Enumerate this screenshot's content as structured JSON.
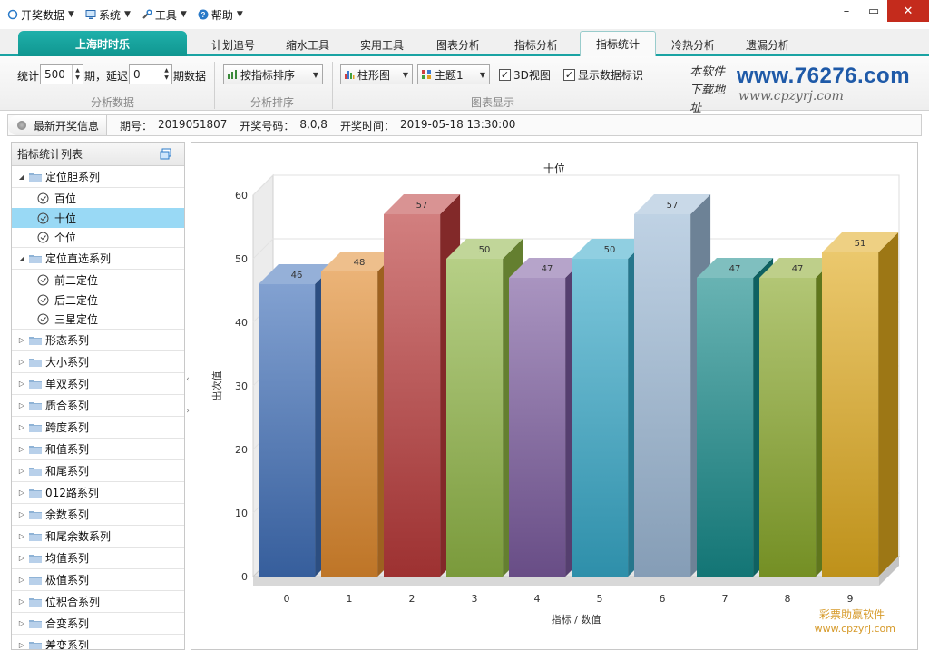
{
  "menu": {
    "items": [
      {
        "label": "开奖数据",
        "icon": "circle-icon"
      },
      {
        "label": "系统",
        "icon": "monitor-icon"
      },
      {
        "label": "工具",
        "icon": "tools-icon"
      },
      {
        "label": "帮助",
        "icon": "help-icon"
      }
    ],
    "window_controls": {
      "minimize": "–",
      "restore": "▭",
      "close": "✕"
    }
  },
  "tabs": {
    "brand": "上海时时乐",
    "items": [
      "计划追号",
      "缩水工具",
      "实用工具",
      "图表分析",
      "指标分析",
      "指标统计",
      "冷热分析",
      "遗漏分析"
    ],
    "active": "指标统计"
  },
  "toolbar": {
    "stat_label": "统计",
    "stat_value": "500",
    "periods_delay_label": "期，延迟",
    "delay_value": "0",
    "period_data_label": "期数据",
    "group1_label": "分析数据",
    "sort_value": "按指标排序",
    "group2_label": "分析排序",
    "chart_type_value": "柱形图",
    "theme_value": "主题1",
    "view3d_label": "3D视图",
    "show_labels_label": "显示数据标识",
    "group3_label": "图表显示",
    "view3d_checked": "✓",
    "show_labels_checked": "✓"
  },
  "watermark": {
    "cn_line1": "本软件",
    "cn_line2": "下载地址",
    "url1": "www.76276.com",
    "url2": "www.cpzyrj.com",
    "bottom_name": "彩票助赢软件",
    "bottom_url": "www.cpzyrj.com"
  },
  "infobar": {
    "pill": "最新开奖信息",
    "issue_label": "期号：",
    "issue_value": "2019051807",
    "numbers_label": "开奖号码：",
    "numbers_value": "8,0,8",
    "time_label": "开奖时间：",
    "time_value": "2019-05-18 13:30:00"
  },
  "sidebar": {
    "title": "指标统计列表",
    "groups": [
      {
        "label": "定位胆系列",
        "expanded": true,
        "children": [
          "百位",
          "十位",
          "个位"
        ]
      },
      {
        "label": "定位直选系列",
        "expanded": true,
        "children": [
          "前二定位",
          "后二定位",
          "三星定位"
        ]
      },
      {
        "label": "形态系列"
      },
      {
        "label": "大小系列"
      },
      {
        "label": "单双系列"
      },
      {
        "label": "质合系列"
      },
      {
        "label": "跨度系列"
      },
      {
        "label": "和值系列"
      },
      {
        "label": "和尾系列"
      },
      {
        "label": "012路系列"
      },
      {
        "label": "余数系列"
      },
      {
        "label": "和尾余数系列"
      },
      {
        "label": "均值系列"
      },
      {
        "label": "极值系列"
      },
      {
        "label": "位积合系列"
      },
      {
        "label": "合变系列"
      },
      {
        "label": "差变系列"
      }
    ],
    "selected": "十位"
  },
  "chart_data": {
    "type": "bar",
    "title": "十位",
    "xlabel": "指标 / 数值",
    "ylabel": "出次值",
    "categories": [
      "0",
      "1",
      "2",
      "3",
      "4",
      "5",
      "6",
      "7",
      "8",
      "9"
    ],
    "values": [
      46,
      48,
      57,
      50,
      47,
      50,
      57,
      47,
      47,
      51
    ],
    "ylim": [
      0,
      60
    ],
    "yticks": [
      0,
      10,
      20,
      30,
      40,
      50,
      60
    ],
    "colors": [
      "#3f6fb8",
      "#e08a2e",
      "#b93a3a",
      "#8fb545",
      "#7a5a9e",
      "#36a8c8",
      "#9cb9d6",
      "#168a8a",
      "#88a82a",
      "#e0aa1e"
    ],
    "grid": true,
    "view3d": true,
    "data_labels": true
  }
}
